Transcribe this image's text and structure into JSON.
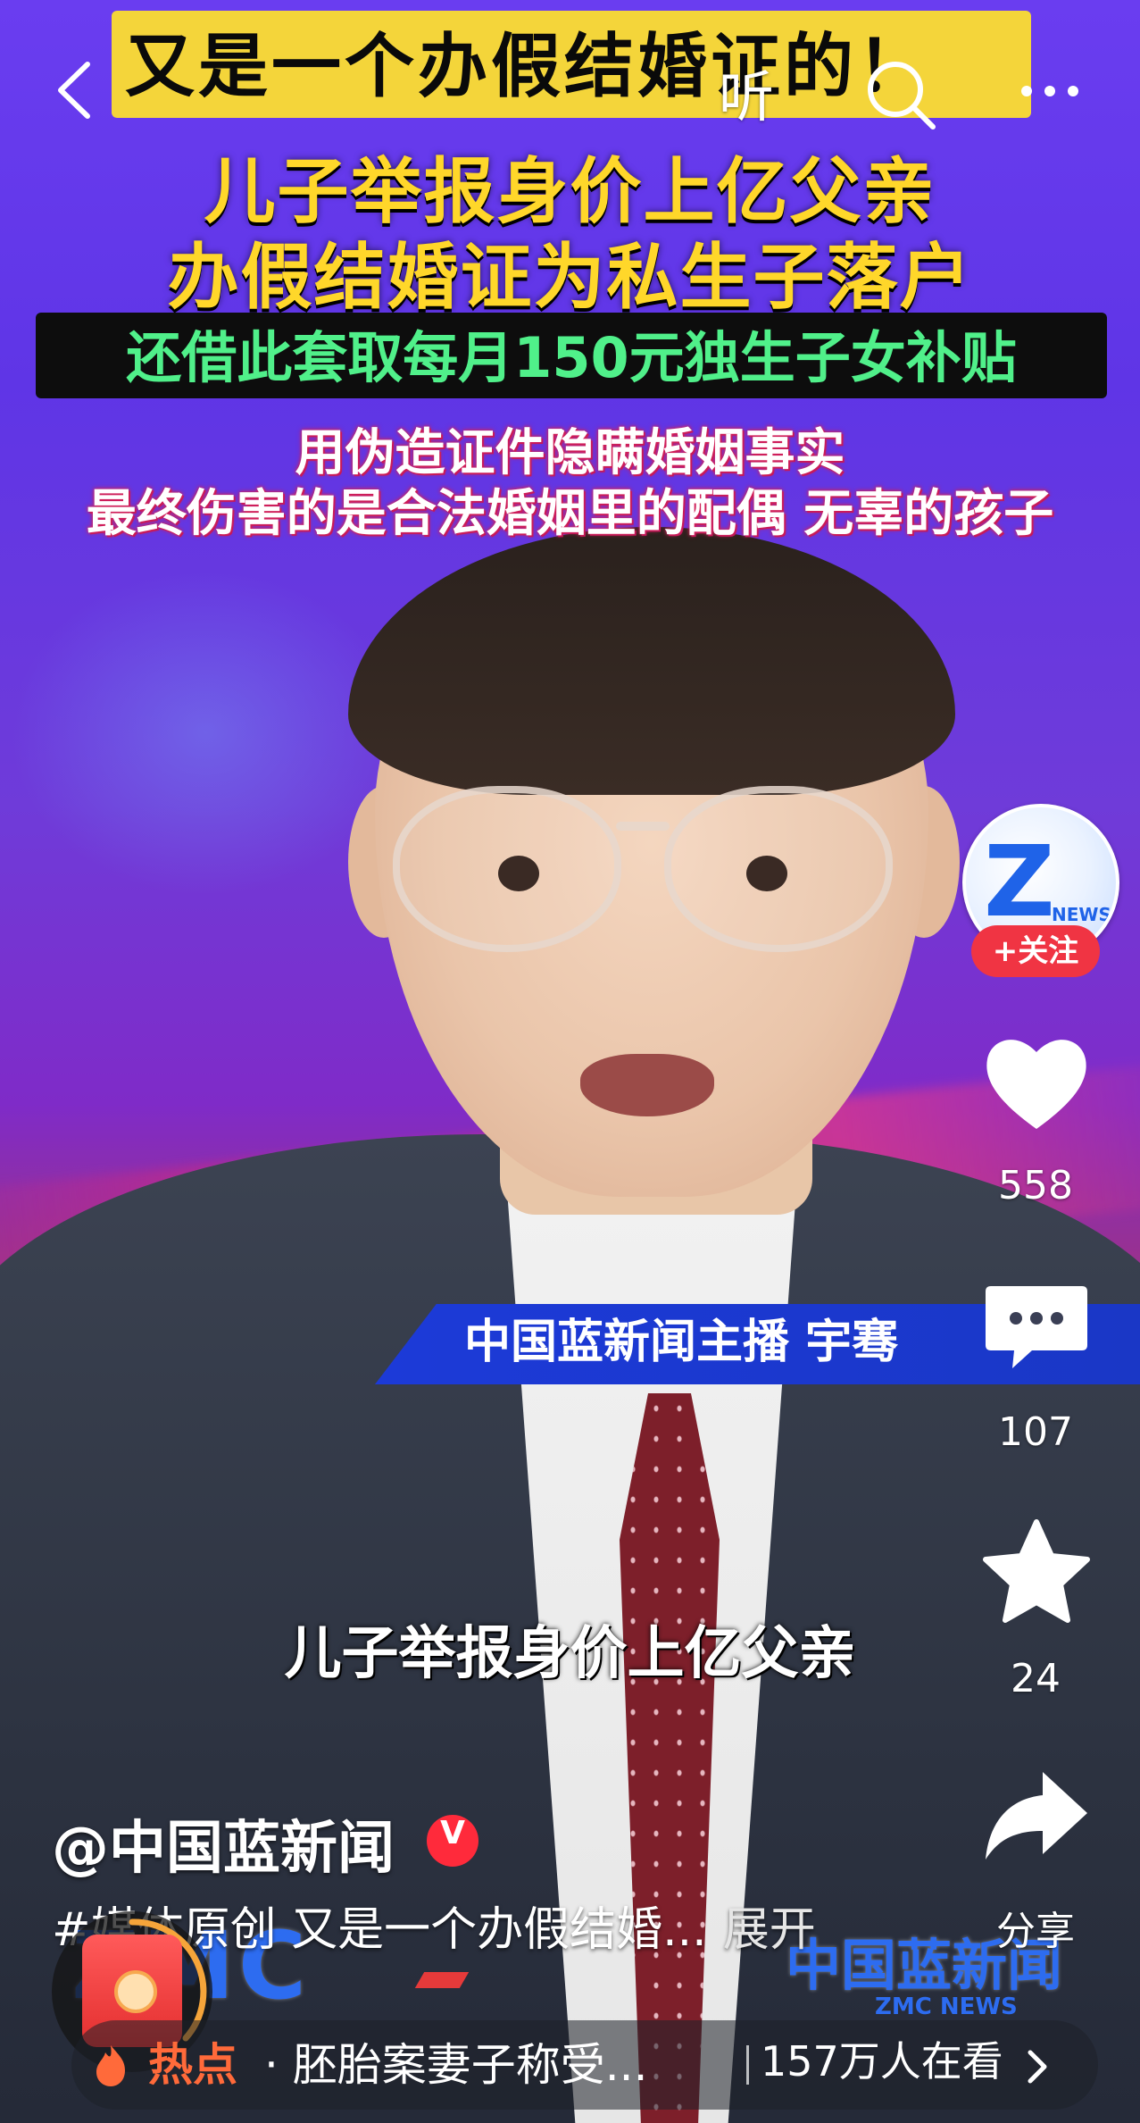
{
  "video": {
    "headline_line1": "又是一个办假结婚证的！",
    "headline_line2": "儿子举报身价上亿父亲",
    "headline_line3": "办假结婚证为私生子落户",
    "green_line": "还借此套取每月150元独生子女补贴",
    "pink_line1": "用伪造证件隐瞒婚姻事实",
    "pink_line2": "最终伤害的是合法婚姻里的配偶 无辜的孩子",
    "ticker": "中国蓝新闻主播 宇骞",
    "subtitle": "儿子举报身价上亿父亲",
    "logo_left": "ZMC",
    "logo_right_cn": "中国蓝新闻",
    "logo_right_en": "ZMC NEWS"
  },
  "topbar": {
    "listen_label": "听"
  },
  "side": {
    "avatar_text": "NEWS",
    "follow_label": "+关注",
    "likes": "558",
    "comments": "107",
    "favorites": "24",
    "share_label": "分享"
  },
  "post": {
    "author": "@中国蓝新闻",
    "verified_mark": "V",
    "description": "#媒体原创  又是一个办假结婚...",
    "expand_label": "展开"
  },
  "hot": {
    "label": "热点",
    "title": "· 胚胎案妻子称受...",
    "viewers": "157万人在看"
  },
  "colors": {
    "follow": "#f03443",
    "hot_label": "#ff6a3a",
    "headline_yellow": "#ffd72a",
    "green_text": "#50f08a"
  }
}
